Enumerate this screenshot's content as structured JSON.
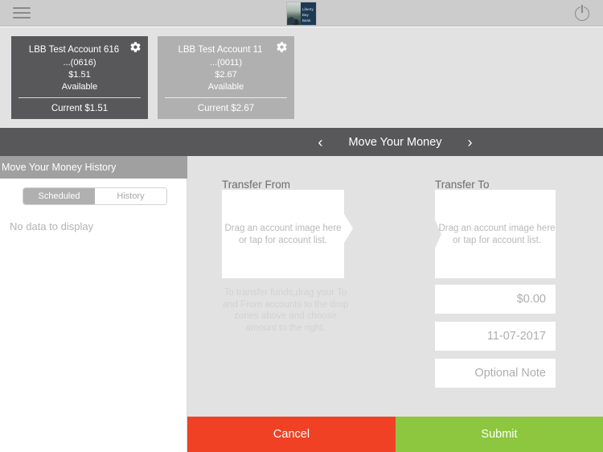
{
  "topbar": {
    "menu_icon": "hamburger-icon",
    "power_icon": "power-icon",
    "logo": {
      "line1": "Liberty",
      "line2": "Bay",
      "line3": "Bank"
    }
  },
  "accounts": [
    {
      "title": "LBB Test Account 616",
      "masked_number": "...(0616)",
      "balance": "$1.51",
      "balance_label": "Available",
      "current": "Current $1.51",
      "gear_icon": "gear-icon",
      "selected": true
    },
    {
      "title": "LBB Test Account 11",
      "masked_number": "...(0011)",
      "balance": "$2.67",
      "balance_label": "Available",
      "current": "Current $2.67",
      "gear_icon": "gear-icon",
      "selected": false
    }
  ],
  "navbar": {
    "title": "Move Your Money",
    "prev_icon": "chevron-left-icon",
    "prev_label": "‹",
    "next_icon": "chevron-right-icon",
    "next_label": "›"
  },
  "sidebar": {
    "header": "Move Your Money History",
    "tabs": [
      {
        "label": "Scheduled",
        "selected": true
      },
      {
        "label": "History",
        "selected": false
      }
    ],
    "empty_message": "No data to display"
  },
  "main": {
    "from": {
      "label": "Transfer From",
      "dropzone_text": "Drag an account image here or tap for account list."
    },
    "to": {
      "label": "Transfer To",
      "dropzone_text": "Drag an account image here or tap for account list."
    },
    "instructions": "To transfer funds,drag your To and From accounts to the drop zones above and choose amount to the right.",
    "fields": [
      {
        "name": "amount",
        "value": "$0.00"
      },
      {
        "name": "date",
        "value": "11-07-2017"
      },
      {
        "name": "note",
        "value": "Optional Note"
      }
    ]
  },
  "footer": {
    "cancel_label": "Cancel",
    "submit_label": "Submit"
  },
  "colors": {
    "cancel": "#f04124",
    "submit": "#8dc63f",
    "navbar": "#58585b",
    "card_selected": "#58585b",
    "card_unselected": "#b0b0b0",
    "panel": "#e2e2e2",
    "sidebar_header": "#a0a0a0",
    "logo_navy": "#1d3a55"
  }
}
